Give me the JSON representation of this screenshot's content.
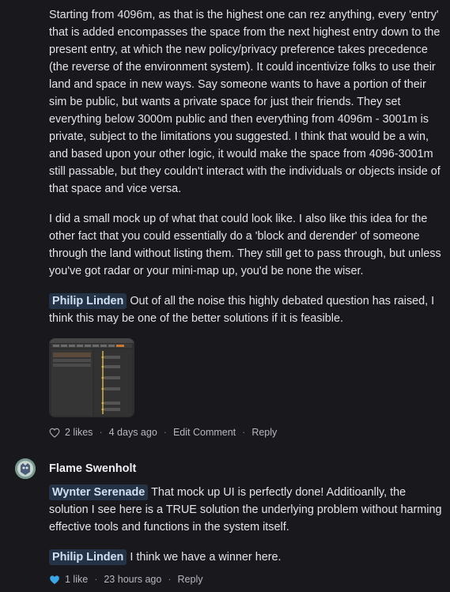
{
  "post": {
    "paragraph1": "Starting from 4096m, as that is the highest one can rez anything, every 'entry' that is added encompasses the space from the next highest entry down to the present entry, at which the new policy/privacy preference takes precedence (the reverse of the environment system). It could incentivize folks to use their land and space in new ways. Say someone wants to have a portion of their sim be public, but wants a private space for just their friends. They set everything below 3000m public and then everything from 4096m - 3001m is private, subject to the limitations you suggested. I think that would be a win, and based upon your other logic, it would make the space from 4096-3001m still passable, but they couldn't interact with the individuals or objects inside of that space and vice versa.",
    "paragraph2": "I did a small mock up of what that could look like. I also like this idea for the other fact that you could essentially do a 'block and derender' of someone through the land without listing them. They still get to pass through, but unless you've got radar or your mini-map up, you'd be none the wiser.",
    "mention": "Philip Linden",
    "paragraph3": "Out of all the noise this highly debated question has raised, I think this may be one of the better solutions if it is feasible.",
    "likes": "2 likes",
    "time": "4 days ago",
    "edit": "Edit Comment",
    "reply": "Reply"
  },
  "reply_comment": {
    "author": "Flame Swenholt",
    "mention1": "Wynter Serenade",
    "text1": "That mock up UI is perfectly done! Additioanlly, the solution I see here is a TRUE solution the underlying problem without harming effective tools and functions in the system itself.",
    "mention2": "Philip Linden",
    "text2": "I think we have a winner here.",
    "likes": "1 like",
    "time": "23 hours ago",
    "reply": "Reply"
  },
  "colors": {
    "background": "#19181d",
    "mention_bg": "#253347",
    "liked_heart": "#3aa6e8"
  },
  "icons": [
    "heart-outline-icon",
    "heart-filled-icon",
    "avatar"
  ]
}
